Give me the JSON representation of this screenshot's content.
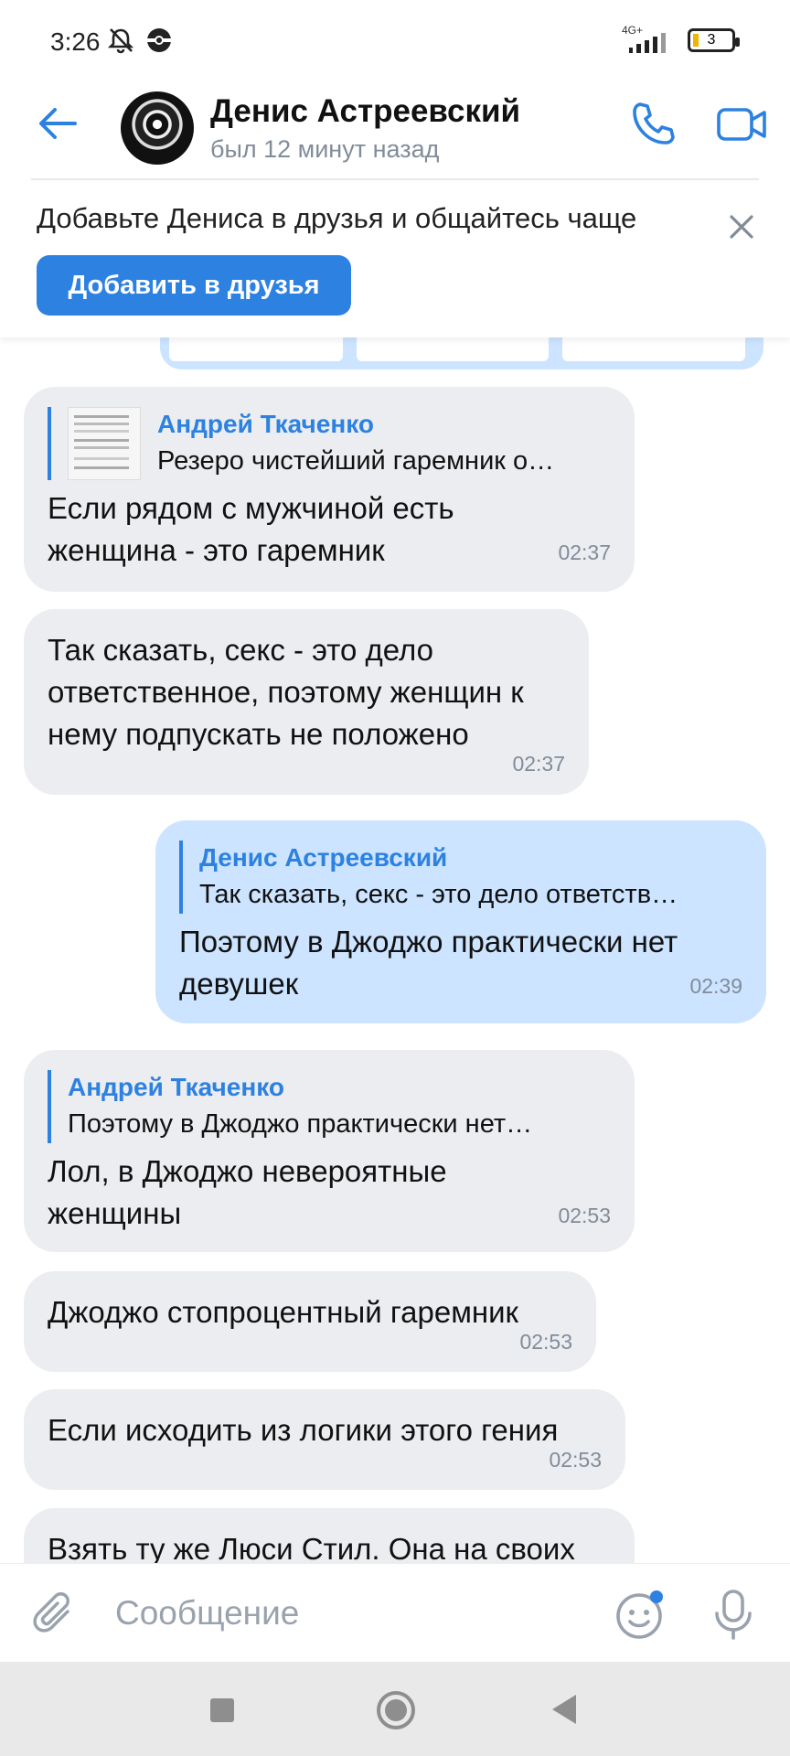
{
  "status_bar": {
    "time": "3:26",
    "network": "4G+",
    "battery": "3"
  },
  "header": {
    "contact_name": "Денис Астреевский",
    "contact_status": "был 12 минут назад"
  },
  "friend_banner": {
    "text": "Добавьте Дениса в друзья и общайтесь чаще",
    "button_label": "Добавить в друзья"
  },
  "messages": [
    {
      "direction": "in",
      "reply": {
        "name": "Андрей Ткаченко",
        "text": "Резеро чистейший гаремник о…"
      },
      "text": "Если рядом с мужчиной есть женщина - это гаремник",
      "time": "02:37"
    },
    {
      "direction": "in",
      "text": "Так сказать, секс - это дело ответственное, поэтому женщин к нему подпускать не положено",
      "time": "02:37"
    },
    {
      "direction": "out",
      "reply": {
        "name": "Денис Астреевский",
        "text": "Так сказать, секс - это дело ответств…"
      },
      "text": "Поэтому в Джоджо практически нет девушек",
      "time": "02:39"
    },
    {
      "direction": "in",
      "reply": {
        "name": "Андрей Ткаченко",
        "text": "Поэтому в Джоджо практически нет…"
      },
      "text": "Лол, в Джоджо невероятные женщины",
      "time": "02:53"
    },
    {
      "direction": "in",
      "text": "Джоджо стопроцентный гаремник",
      "time": "02:53"
    },
    {
      "direction": "in",
      "text": "Если исходить из логики этого гения",
      "time": "02:53"
    },
    {
      "direction": "in",
      "text": "Взять ту же Люси Стил. Она на своих"
    }
  ],
  "input": {
    "placeholder": "Сообщение"
  },
  "colors": {
    "accent": "#2d81e0",
    "incoming_bubble": "#ebedf0",
    "outgoing_bubble": "#cce4ff",
    "secondary_text": "#818c99"
  }
}
